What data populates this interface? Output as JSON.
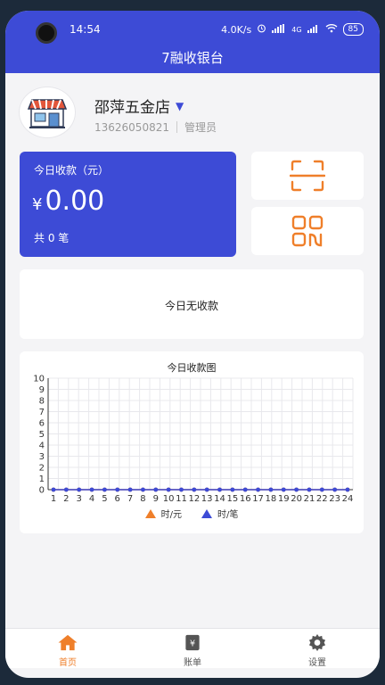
{
  "status_bar": {
    "time": "14:54",
    "network_speed": "4.0K/s",
    "signal": "4G",
    "battery": "85"
  },
  "header": {
    "title": "7融收银台"
  },
  "shop": {
    "name": "邵萍五金店",
    "phone": "13626050821",
    "role": "管理员"
  },
  "income": {
    "title": "今日收款（元）",
    "currency": "¥",
    "amount": "0.00",
    "count_text": "共 0 笔"
  },
  "quick_actions": [
    {
      "name": "scan",
      "icon": "scan-icon"
    },
    {
      "name": "qr-code",
      "icon": "qr-code-icon"
    }
  ],
  "empty_state": {
    "text": "今日无收款"
  },
  "chart": {
    "title": "今日收款图",
    "legend": [
      {
        "label": "时/元",
        "color": "#ef7f2a"
      },
      {
        "label": "时/笔",
        "color": "#3d4bd6"
      }
    ]
  },
  "chart_data": {
    "type": "line",
    "title": "今日收款图",
    "x": [
      1,
      2,
      3,
      4,
      5,
      6,
      7,
      8,
      9,
      10,
      11,
      12,
      13,
      14,
      15,
      16,
      17,
      18,
      19,
      20,
      21,
      22,
      23,
      24
    ],
    "ylim": [
      0,
      10
    ],
    "yticks": [
      0,
      1,
      2,
      3,
      4,
      5,
      6,
      7,
      8,
      9,
      10
    ],
    "grid": true,
    "legend_position": "bottom",
    "series": [
      {
        "name": "时/元",
        "color": "#ef7f2a",
        "values": [
          0,
          0,
          0,
          0,
          0,
          0,
          0,
          0,
          0,
          0,
          0,
          0,
          0,
          0,
          0,
          0,
          0,
          0,
          0,
          0,
          0,
          0,
          0,
          0
        ]
      },
      {
        "name": "时/笔",
        "color": "#3d4bd6",
        "values": [
          0,
          0,
          0,
          0,
          0,
          0,
          0,
          0,
          0,
          0,
          0,
          0,
          0,
          0,
          0,
          0,
          0,
          0,
          0,
          0,
          0,
          0,
          0,
          0
        ]
      }
    ]
  },
  "tabbar": {
    "items": [
      {
        "label": "首页",
        "icon": "home-icon",
        "active": true
      },
      {
        "label": "账单",
        "icon": "bill-icon",
        "active": false
      },
      {
        "label": "设置",
        "icon": "gear-icon",
        "active": false
      }
    ]
  }
}
